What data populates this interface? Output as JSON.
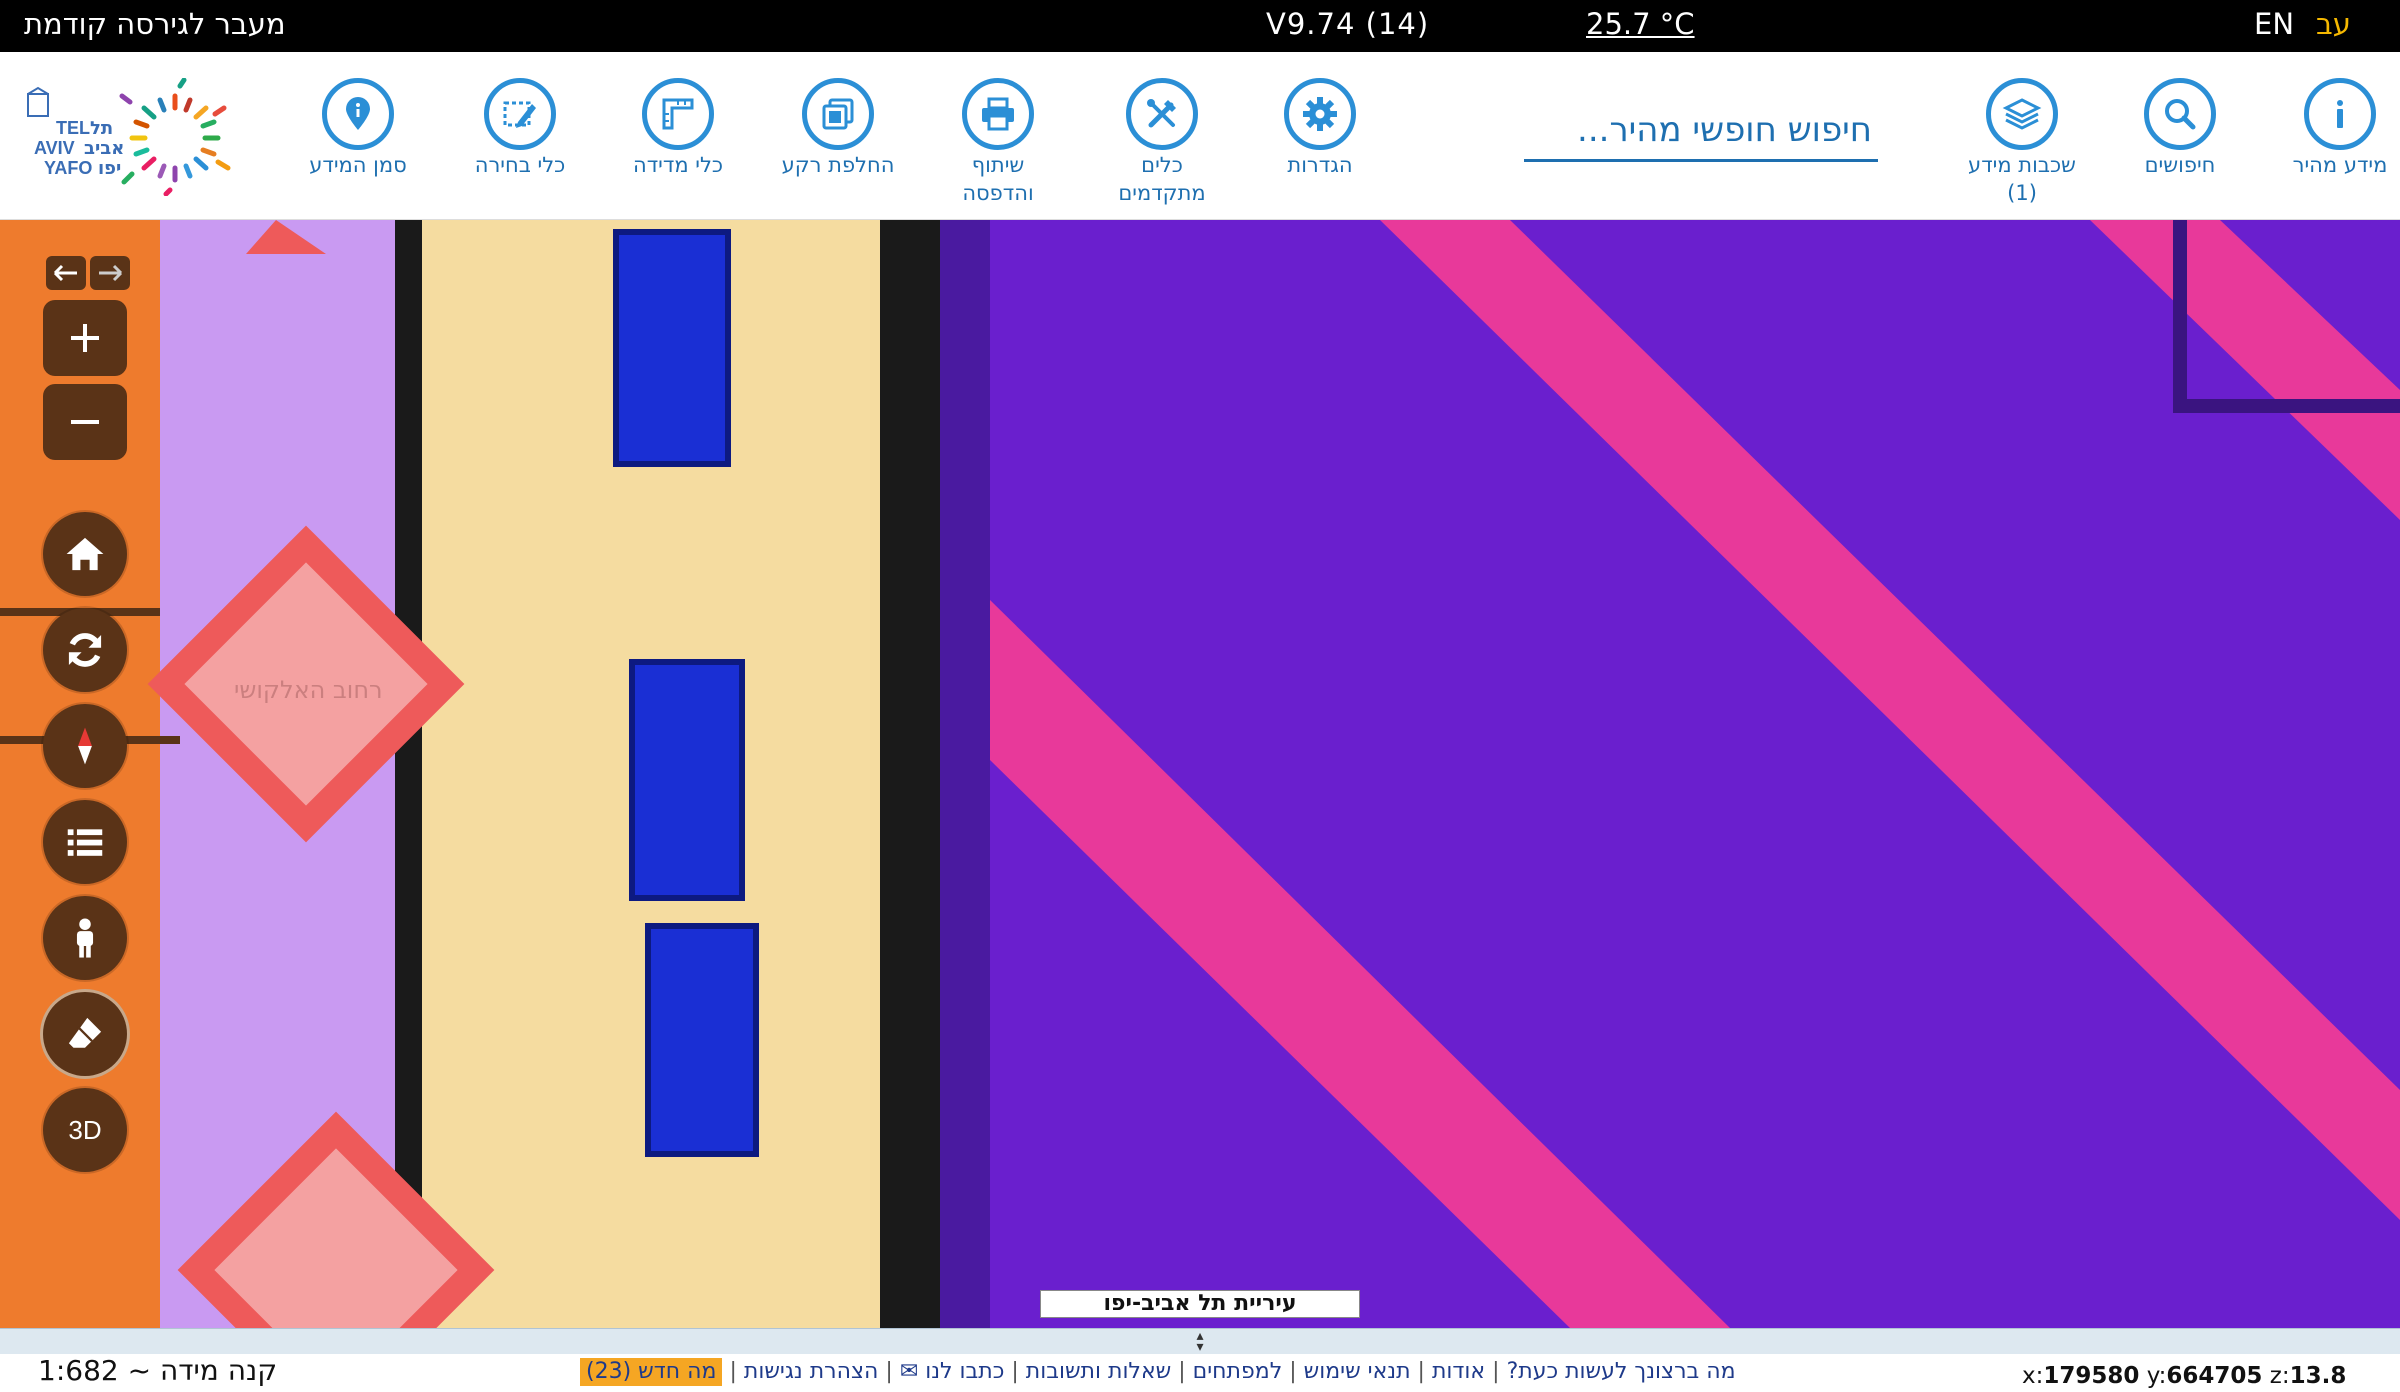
{
  "topbar": {
    "prev_version": "מעבר לגירסה קודמת",
    "version": "V9.74 (14)",
    "temperature": "25.7 °C",
    "lang_en": "EN",
    "lang_he": "עב"
  },
  "toolbar": {
    "quick_info": "מידע מהיר",
    "searches": "חיפושים",
    "info_layers_line1": "שכבות מידע",
    "info_layers_line2": "(1)",
    "search_placeholder": "חיפוש חופשי מהיר...",
    "settings": "הגדרות",
    "advanced_line1": "כלים",
    "advanced_line2": "מתקדמים",
    "share_line1": "שיתוף",
    "share_line2": "והדפסה",
    "basemap": "החלפת רקע",
    "measure": "כלי מדידה",
    "select": "כלי בחירה",
    "mark": "סמן המידע"
  },
  "logo": {
    "text_en_top": "TEL",
    "text_en_mid": "AVIV",
    "text_en_bot": "YAFO",
    "text_he_top": "תל",
    "text_he_mid": "אביב",
    "text_he_bot": "יפו"
  },
  "map": {
    "controls": [
      "back-arrow",
      "forward-arrow",
      "zoom-in",
      "zoom-out",
      "home",
      "refresh",
      "compass",
      "legend",
      "street-view",
      "eraser",
      "3d"
    ],
    "three_d": "3D",
    "attribution": "עיריית תל אביב-יפו",
    "street_label": "רחוב האלקושי",
    "colors": {
      "purple": "#6a1fce",
      "pink": "#e8399a",
      "orange": "#ee7b2d",
      "lilac": "#c99af2",
      "cream": "#f5dca0",
      "blue": "#1a2fd4",
      "salmon": "#f4a1a1"
    }
  },
  "bottom": {
    "scale": "קנה מידה ~ 1:682",
    "links": {
      "what_do": "מה ברצונך לעשות כעת?",
      "about": "אודות",
      "terms": "תנאי שימוש",
      "developers": "למפתחים",
      "faq": "שאלות ותשובות",
      "contact": "כתבו לנו ✉",
      "accessibility": "הצהרת נגישות",
      "whats_new": "מה חדש (23)"
    },
    "coords": {
      "x_label": "x:",
      "x": "179580",
      "y_label": "y:",
      "y": "664705",
      "z_label": "z:",
      "z": "13.8"
    }
  }
}
